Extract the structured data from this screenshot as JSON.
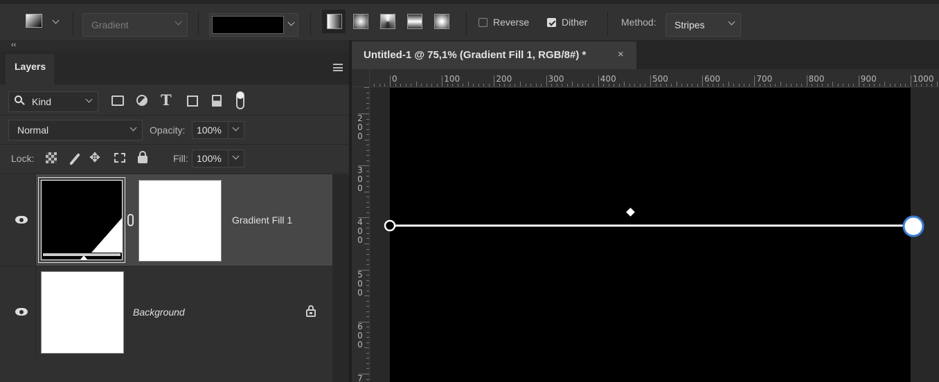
{
  "options_bar": {
    "gradient_label": "Gradient",
    "styles": [
      "linear-gradient-icon",
      "radial-gradient-icon",
      "angle-gradient-icon",
      "reflected-gradient-icon",
      "diamond-gradient-icon"
    ],
    "reverse_label": "Reverse",
    "reverse_checked": false,
    "dither_label": "Dither",
    "dither_checked": true,
    "method_label": "Method:",
    "method_value": "Stripes"
  },
  "panel": {
    "collapse_label": "‹‹",
    "tab_label": "Layers",
    "filter_label": "Kind",
    "blend_mode": "Normal",
    "opacity_label": "Opacity:",
    "opacity_value": "100%",
    "lock_label": "Lock:",
    "fill_label": "Fill:",
    "fill_value": "100%"
  },
  "layers": [
    {
      "name": "Gradient Fill 1",
      "selected": true,
      "visible": true
    },
    {
      "name": "Background",
      "selected": false,
      "visible": true,
      "locked": true
    }
  ],
  "document": {
    "tab_title": "Untitled-1 @ 75,1% (Gradient Fill 1, RGB/8#) *",
    "close_glyph": "×",
    "ruler_h_labels": [
      "0",
      "100",
      "200",
      "300",
      "400",
      "500",
      "600",
      "700",
      "800",
      "900",
      "1000"
    ],
    "ruler_v_labels": [
      "2\n0\n0",
      "3\n0\n0",
      "4\n0\n0",
      "5\n0\n0",
      "6\n0\n0",
      "7"
    ]
  },
  "colors": {
    "accent": "#3a7fd5",
    "canvas": "#000000",
    "panel_bg": "#323232"
  }
}
